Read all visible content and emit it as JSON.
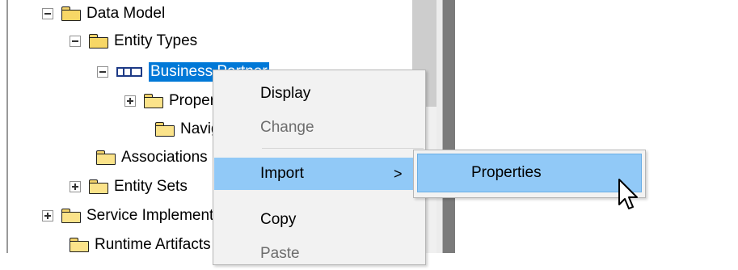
{
  "tree": {
    "rows": [
      {
        "label": "Data Model"
      },
      {
        "label": "Entity Types"
      },
      {
        "label": "Business Partner"
      },
      {
        "label": "Properties"
      },
      {
        "label": "Navigation Properties"
      },
      {
        "label": "Associations"
      },
      {
        "label": "Entity Sets"
      },
      {
        "label": "Service Implementation"
      },
      {
        "label": "Runtime Artifacts"
      }
    ]
  },
  "context_menu": {
    "items": [
      {
        "label": "Display",
        "enabled": true
      },
      {
        "label": "Change",
        "enabled": false
      },
      {
        "label": "Import",
        "enabled": true,
        "highlighted": true,
        "submenu_indicator": ">"
      },
      {
        "label": "Copy",
        "enabled": true
      },
      {
        "label": "Paste",
        "enabled": false
      }
    ]
  },
  "submenu": {
    "items": [
      {
        "label": "Properties",
        "highlighted": true
      }
    ]
  },
  "colors": {
    "selection": "#0078d7",
    "menu_highlight": "#91c9f7",
    "menu_background": "#f2f2f2",
    "disabled_text": "#6d6d6d"
  }
}
